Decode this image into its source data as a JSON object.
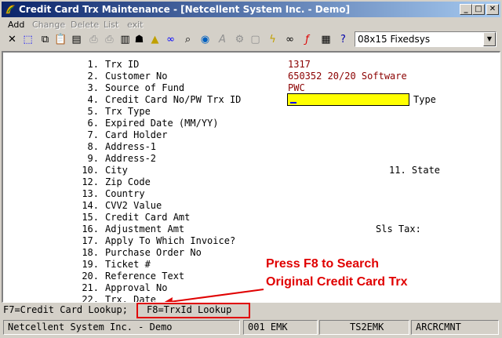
{
  "window": {
    "title": "Credit Card Trx Maintenance - [Netcellent System Inc. - Demo]",
    "min": "_",
    "max": "□",
    "close": "✕"
  },
  "menu": [
    {
      "label": "Add",
      "enabled": true
    },
    {
      "label": "Change",
      "enabled": false
    },
    {
      "label": "Delete",
      "enabled": false
    },
    {
      "label": "List",
      "enabled": false
    },
    {
      "label": "exit",
      "enabled": false
    }
  ],
  "toolbar": {
    "font_select": "08x15 Fixedsys",
    "icons": [
      "close-x-icon",
      "select-icon",
      "copy-icon",
      "paste-icon",
      "clipboard-icon",
      "print-icon",
      "printer-setup-icon",
      "notes-icon",
      "user-lock-icon",
      "warning-icon",
      "binoculars-icon",
      "search-icon",
      "globe-icon",
      "letter-a-icon",
      "gear-icon",
      "document-icon",
      "lightning-icon",
      "link-icon",
      "function-icon",
      "calculator-icon",
      "help-pointer-icon"
    ]
  },
  "fields": [
    {
      "num": "1.",
      "label": "Trx ID",
      "value": "1317"
    },
    {
      "num": "2.",
      "label": "Customer No",
      "value": "650352 20/20 Software"
    },
    {
      "num": "3.",
      "label": "Source of Fund",
      "value": "PWC"
    },
    {
      "num": "4.",
      "label": "Credit Card No/PW Trx ID",
      "value": ""
    },
    {
      "num": "5.",
      "label": "Trx Type",
      "value": ""
    },
    {
      "num": "6.",
      "label": "Expired Date (MM/YY)",
      "value": ""
    },
    {
      "num": "7.",
      "label": "Card Holder",
      "value": ""
    },
    {
      "num": "8.",
      "label": "Address-1",
      "value": ""
    },
    {
      "num": "9.",
      "label": "Address-2",
      "value": ""
    },
    {
      "num": "10.",
      "label": "City",
      "value": ""
    },
    {
      "num": "12.",
      "label": "Zip Code",
      "value": ""
    },
    {
      "num": "13.",
      "label": "Country",
      "value": ""
    },
    {
      "num": "14.",
      "label": "CVV2 Value",
      "value": ""
    },
    {
      "num": "15.",
      "label": "Credit Card Amt",
      "value": ""
    },
    {
      "num": "16.",
      "label": "Adjustment Amt",
      "value": ""
    },
    {
      "num": "17.",
      "label": "Apply To Which Invoice?",
      "value": ""
    },
    {
      "num": "18.",
      "label": "Purchase Order No",
      "value": ""
    },
    {
      "num": "19.",
      "label": "Ticket #",
      "value": ""
    },
    {
      "num": "20.",
      "label": "Reference Text",
      "value": ""
    },
    {
      "num": "21.",
      "label": "Approval No",
      "value": ""
    },
    {
      "num": "22.",
      "label": "Trx. Date",
      "value": ""
    }
  ],
  "extras": {
    "type_label": "Type",
    "state_label": "11. State",
    "sls_tax_label": "Sls Tax:"
  },
  "annotation": {
    "line1": "Press F8 to Search",
    "line2": "Original Credit Card Trx"
  },
  "fkeys": {
    "f7": "F7=Credit Card Lookup;",
    "f8": "F8=TrxId Lookup"
  },
  "status": {
    "company": "Netcellent System Inc. - Demo",
    "user": "001 EMK",
    "terminal": "TS2EMK",
    "program": "ARCRCMNT"
  }
}
